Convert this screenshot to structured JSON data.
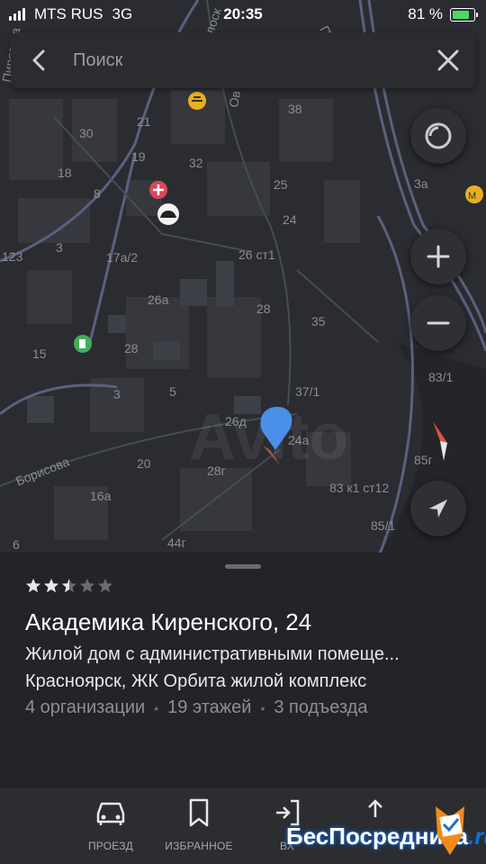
{
  "status_bar": {
    "carrier": "MTS RUS",
    "network": "3G",
    "time": "20:35",
    "battery_percent": "81 %",
    "battery_level": 0.81
  },
  "search": {
    "placeholder": "Поиск"
  },
  "map": {
    "labels": [
      "30",
      "21",
      "19",
      "32",
      "38",
      "18",
      "8",
      "25",
      "24",
      "3а",
      "3",
      "123",
      "17а/2",
      "26 ст1",
      "26а",
      "28",
      "35",
      "15",
      "28",
      "3",
      "5",
      "37/1",
      "83/1",
      "26д",
      "24а",
      "20",
      "28г",
      "16а",
      "83 к1 ст12",
      "85г",
      "85/1",
      "44г",
      "6"
    ],
    "streets": [
      "Борисова",
      "Пирогова",
      "Калоск",
      "Ов",
      "Проспек"
    ],
    "watermark": "Avito"
  },
  "place": {
    "rating": 2.5,
    "rating_max": 5,
    "title": "Академика Киренского, 24",
    "description": "Жилой дом с административными помеще...",
    "city": "Красноярск, ЖК Орбита жилой комплекс",
    "organizations": "4 организации",
    "floors": "19 этажей",
    "entrances": "3 подъезда"
  },
  "toolbar": {
    "route_label": "ПРОЕЗД",
    "favorites_label": "ИЗБРАННОЕ",
    "enter_label": "ВХ",
    "share_label": ""
  },
  "overlay": {
    "brand": "БесПосредника",
    "brand_tld": ".ru"
  },
  "colors": {
    "accent_pin": "#4a90e8",
    "star_on": "#e8e8ea",
    "star_off": "#6a6b70",
    "map_bg": "#2a2c31"
  }
}
